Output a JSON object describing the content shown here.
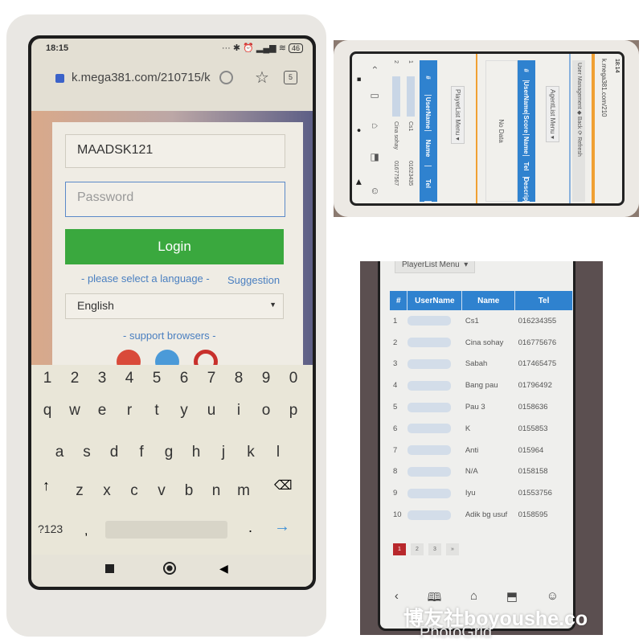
{
  "login_phone": {
    "status_time": "18:15",
    "battery": "46",
    "url": "k.mega381.com/210715/k",
    "tabs_count": "5",
    "username_value": "MAADSK121",
    "password_placeholder": "Password",
    "login_label": "Login",
    "language_link": "- please select a language -",
    "suggestion_link": "Suggestion",
    "language_selected": "English",
    "support_browsers": "- support browsers -",
    "keyboard": {
      "row1": [
        "1",
        "2",
        "3",
        "4",
        "5",
        "6",
        "7",
        "8",
        "9",
        "0"
      ],
      "row2": [
        "q",
        "w",
        "e",
        "r",
        "t",
        "y",
        "u",
        "i",
        "o",
        "p"
      ],
      "row3": [
        "a",
        "s",
        "d",
        "f",
        "g",
        "h",
        "j",
        "k",
        "l"
      ],
      "row4": [
        "z",
        "x",
        "c",
        "v",
        "b",
        "n",
        "m"
      ],
      "symbols": "?123",
      "comma": ",",
      "period": "."
    },
    "colors": {
      "login_button": "#3aa83e",
      "link": "#4a7fc0"
    }
  },
  "agent_phone": {
    "status_time": "18:14",
    "url": "k.mega381.com/210",
    "breadcrumb": "User Management",
    "back": "Back",
    "refresh": "Refresh",
    "agent_menu": "AgentList Menu",
    "agent_columns": [
      "#",
      "UserName",
      "Score",
      "Name",
      "Tel",
      "Descrip"
    ],
    "no_data": "No Data",
    "player_menu": "PlayerList Menu",
    "player_columns": [
      "#",
      "UserName",
      "Name",
      "Tel"
    ],
    "rows": [
      {
        "n": "1",
        "name": "Cs1",
        "tel": "01623435"
      },
      {
        "n": "2",
        "name": "Cina sohay",
        "tel": "01677567"
      }
    ]
  },
  "player_phone": {
    "menu": "PlayerList Menu",
    "columns": [
      "#",
      "UserName",
      "Name",
      "Tel"
    ],
    "rows": [
      {
        "n": "1",
        "name": "Cs1",
        "tel": "016234355"
      },
      {
        "n": "2",
        "name": "Cina sohay",
        "tel": "016775676"
      },
      {
        "n": "3",
        "name": "Sabah",
        "tel": "017465475"
      },
      {
        "n": "4",
        "name": "Bang pau",
        "tel": "01796492"
      },
      {
        "n": "5",
        "name": "Pau 3",
        "tel": "0158636"
      },
      {
        "n": "6",
        "name": "K",
        "tel": "0155853"
      },
      {
        "n": "7",
        "name": "Anti",
        "tel": "015964"
      },
      {
        "n": "8",
        "name": "N/A",
        "tel": "0158158"
      },
      {
        "n": "9",
        "name": "Iyu",
        "tel": "01553756"
      },
      {
        "n": "10",
        "name": "Adik bg usuf",
        "tel": "0158595"
      }
    ],
    "pages": [
      "1",
      "2",
      "3",
      "»"
    ],
    "active_page": "1",
    "colors": {
      "header": "#2f82cf",
      "active_page": "#b8282c"
    }
  },
  "watermark": {
    "text": "博友社boyoushe.co",
    "app": "PhotoGrid"
  }
}
